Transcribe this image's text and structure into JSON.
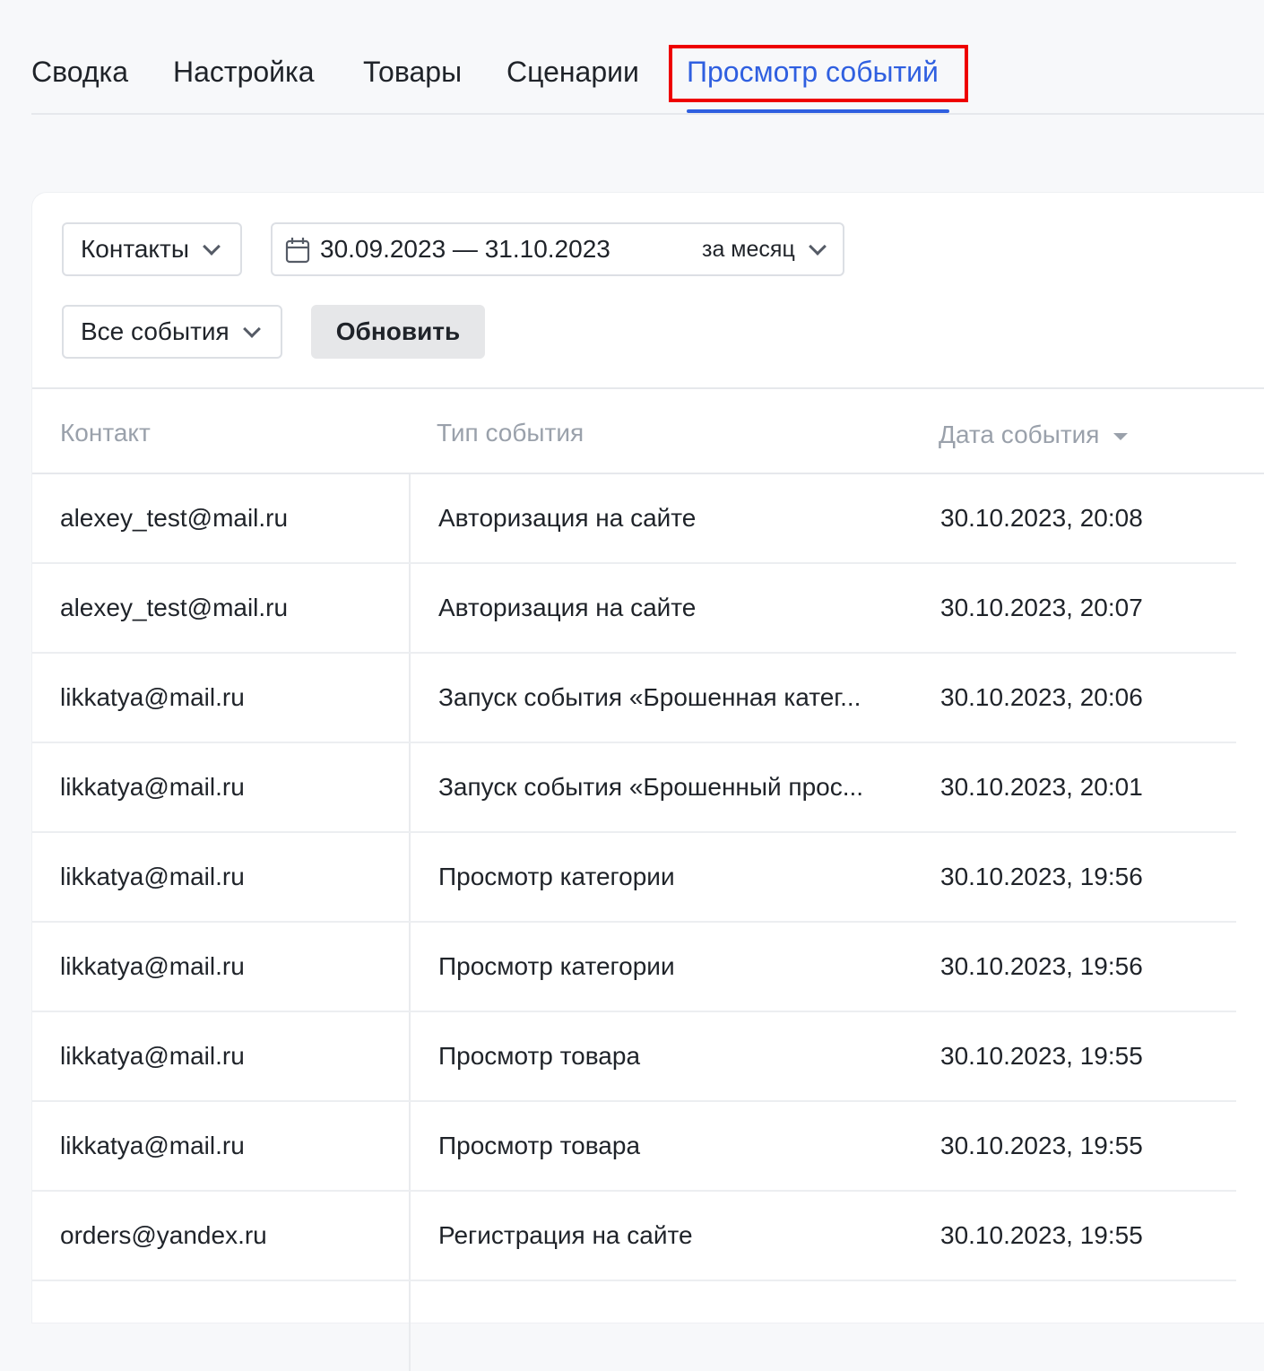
{
  "tabs": [
    {
      "label": "Сводка"
    },
    {
      "label": "Настройка"
    },
    {
      "label": "Товары"
    },
    {
      "label": "Сценарии"
    },
    {
      "label": "Просмотр событий",
      "active": true
    }
  ],
  "filters": {
    "contacts_select": "Контакты",
    "date_range": "30.09.2023 — 31.10.2023",
    "period": "за месяц",
    "events_select": "Все события",
    "refresh_button": "Обновить"
  },
  "table": {
    "headers": [
      "Контакт",
      "Тип события",
      "Дата события"
    ],
    "sort_column": "Дата события",
    "rows": [
      [
        "alexey_test@mail.ru",
        "Авторизация на сайте",
        "30.10.2023, 20:08"
      ],
      [
        "alexey_test@mail.ru",
        "Авторизация на сайте",
        "30.10.2023, 20:07"
      ],
      [
        "likkatya@mail.ru",
        "Запуск события «Брошенная катег...",
        "30.10.2023, 20:06"
      ],
      [
        "likkatya@mail.ru",
        "Запуск события «Брошенный прос...",
        "30.10.2023, 20:01"
      ],
      [
        "likkatya@mail.ru",
        "Просмотр категории",
        "30.10.2023, 19:56"
      ],
      [
        "likkatya@mail.ru",
        "Просмотр категории",
        "30.10.2023, 19:56"
      ],
      [
        "likkatya@mail.ru",
        "Просмотр товара",
        "30.10.2023, 19:55"
      ],
      [
        "likkatya@mail.ru",
        "Просмотр товара",
        "30.10.2023, 19:55"
      ],
      [
        "orders@yandex.ru",
        "Регистрация на сайте",
        "30.10.2023, 19:55"
      ]
    ]
  },
  "colors": {
    "accent": "#2f5fe0",
    "highlight": "#ee0000",
    "header_text": "#9aa1ab",
    "button_bg": "#e6e7e9"
  }
}
